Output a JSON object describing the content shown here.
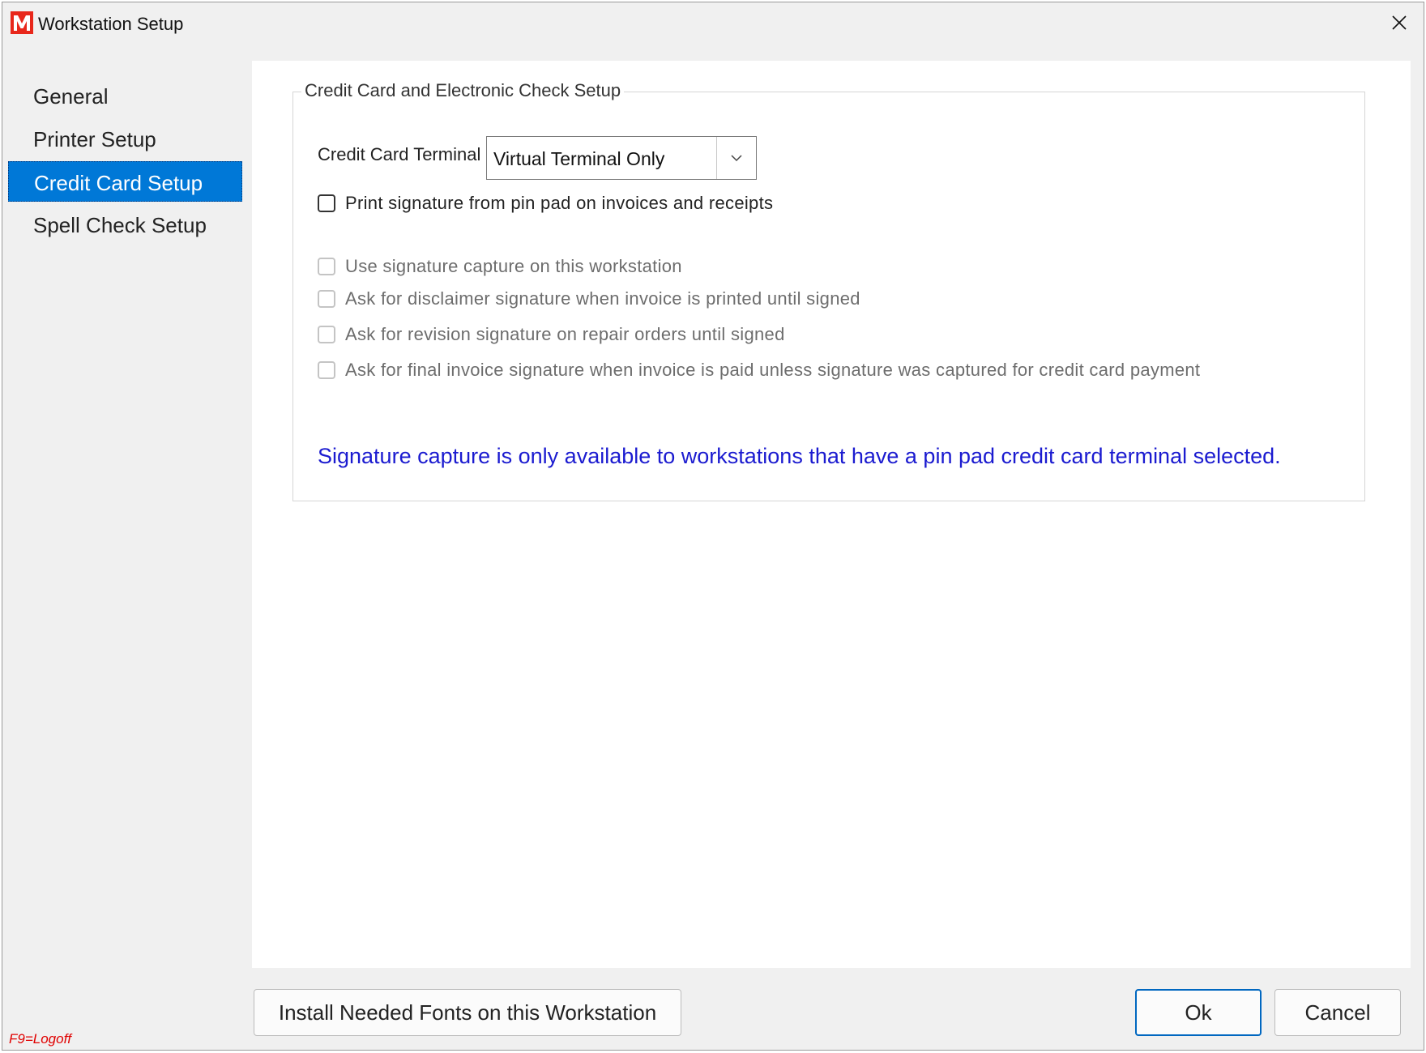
{
  "window": {
    "title": "Workstation Setup"
  },
  "nav": {
    "items": [
      {
        "label": "General",
        "active": false
      },
      {
        "label": "Printer Setup",
        "active": false
      },
      {
        "label": "Credit Card Setup",
        "active": true
      },
      {
        "label": "Spell Check Setup",
        "active": false
      }
    ]
  },
  "group": {
    "title": "Credit Card and Electronic Check Setup",
    "terminal_label": "Credit Card Terminal",
    "terminal_value": "Virtual Terminal Only",
    "checkboxes": [
      {
        "label": "Print signature from pin pad on invoices and receipts",
        "checked": false,
        "enabled": true
      },
      {
        "label": "Use signature capture on this workstation",
        "checked": false,
        "enabled": false
      },
      {
        "label": "Ask for disclaimer signature when invoice is printed until signed",
        "checked": false,
        "enabled": false
      },
      {
        "label": "Ask for revision signature on repair orders until signed",
        "checked": false,
        "enabled": false
      },
      {
        "label": "Ask for final invoice signature when invoice is paid unless signature was captured for credit card payment",
        "checked": false,
        "enabled": false
      }
    ],
    "note": "Signature capture is only available to workstations that have a pin pad credit card terminal selected.",
    "note_color": "#1b1bd0"
  },
  "footer": {
    "install_fonts_label": "Install Needed Fonts on this Workstation",
    "ok_label": "Ok",
    "cancel_label": "Cancel",
    "logoff_hint": "F9=Logoff"
  },
  "colors": {
    "accent": "#0078d7",
    "logo": "#e8271b",
    "logoff": "#e00000"
  },
  "icons": {
    "logo": "app-logo-m",
    "close": "close-icon",
    "dropdown": "chevron-down-icon"
  }
}
